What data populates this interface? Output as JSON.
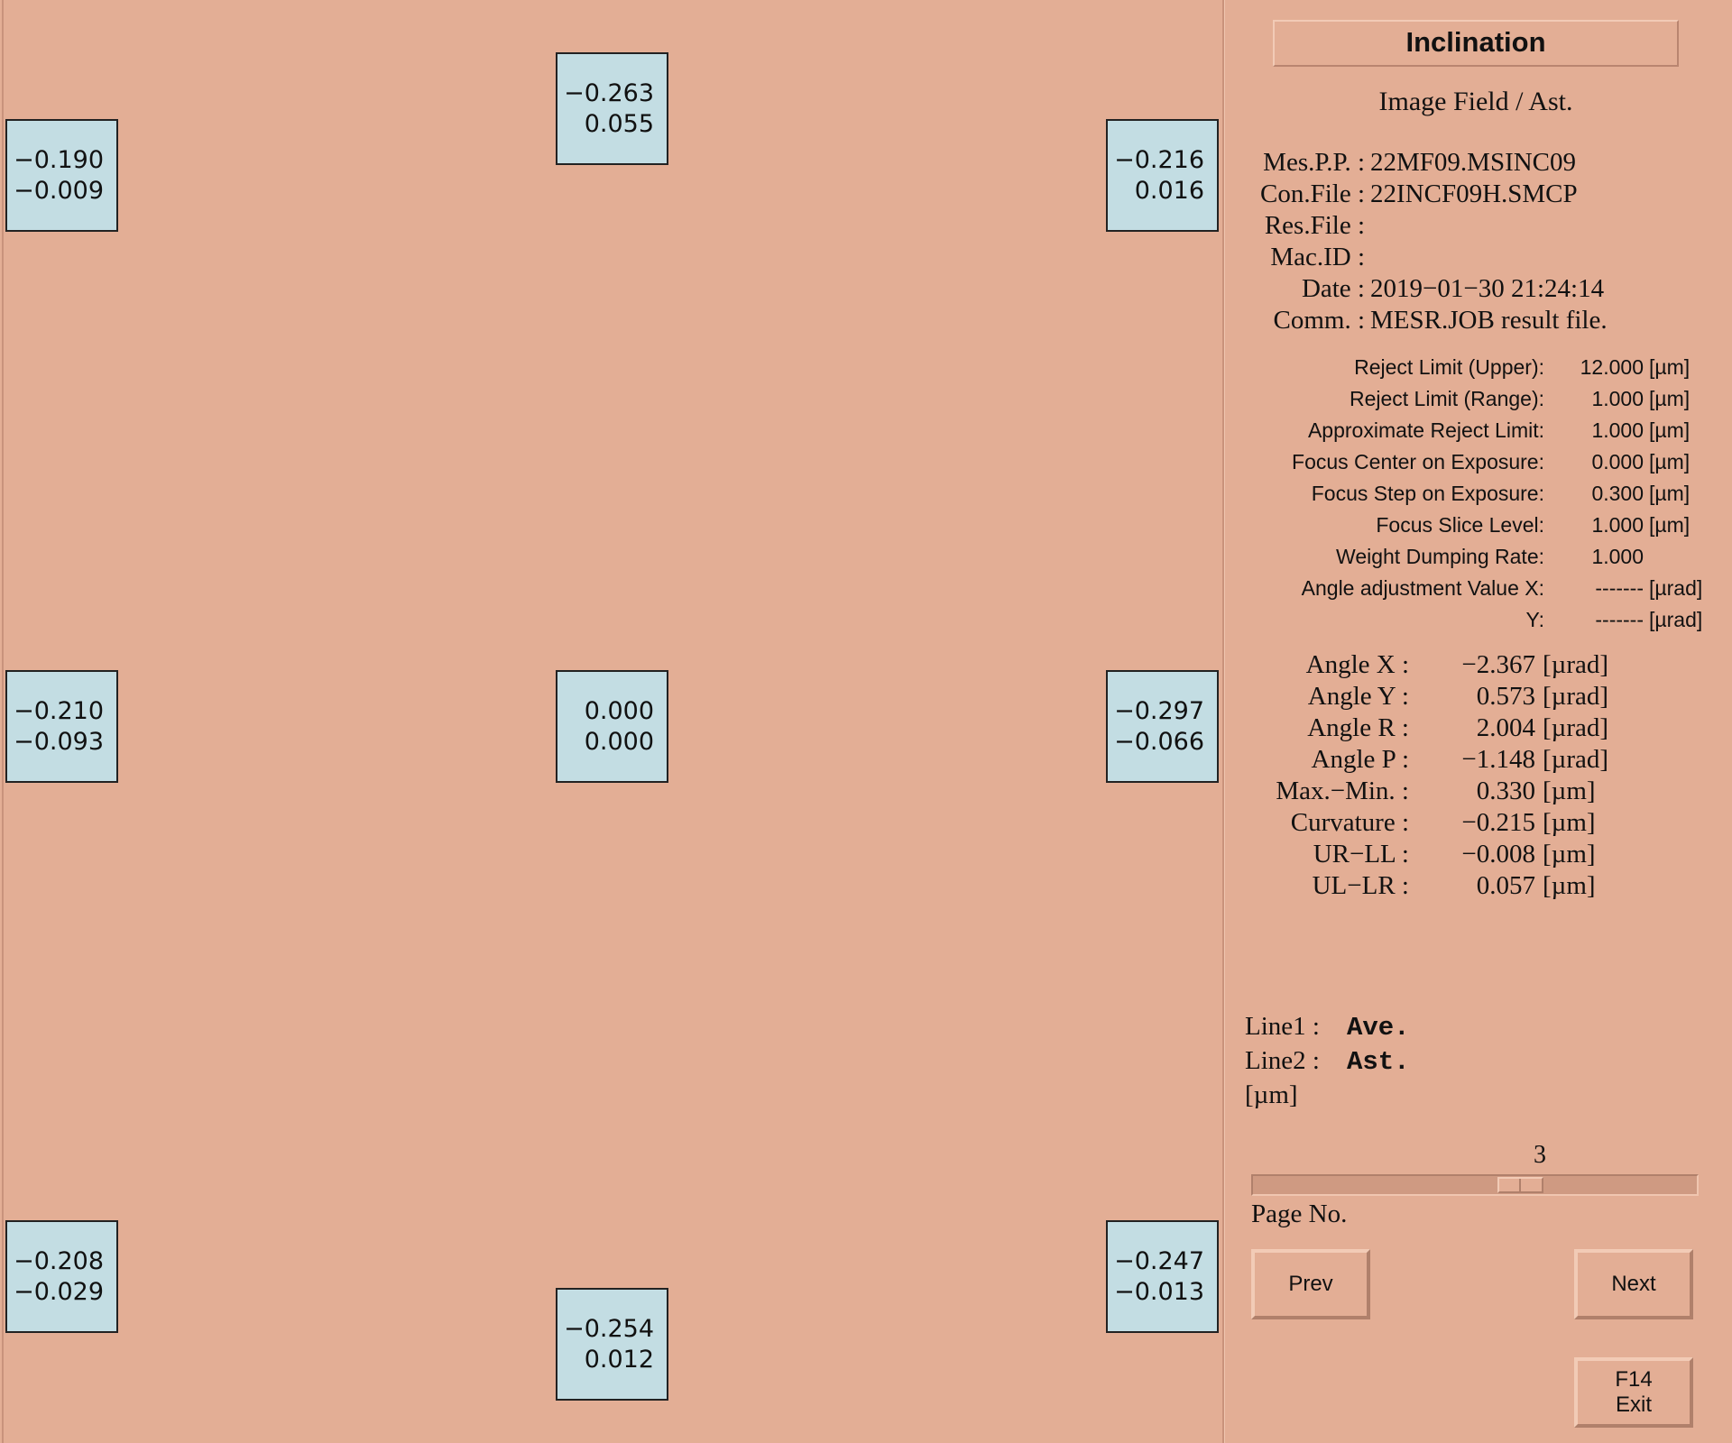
{
  "field_boxes": [
    {
      "pos": "top-left",
      "line1": "−0.190",
      "line2": "−0.009"
    },
    {
      "pos": "top-center",
      "line1": "−0.263",
      "line2": "0.055"
    },
    {
      "pos": "top-right",
      "line1": "−0.216",
      "line2": "0.016"
    },
    {
      "pos": "middle-left",
      "line1": "−0.210",
      "line2": "−0.093"
    },
    {
      "pos": "center",
      "line1": "0.000",
      "line2": "0.000"
    },
    {
      "pos": "middle-right",
      "line1": "−0.297",
      "line2": "−0.066"
    },
    {
      "pos": "bottom-left",
      "line1": "−0.208",
      "line2": "−0.029"
    },
    {
      "pos": "bottom-center",
      "line1": "−0.254",
      "line2": "0.012"
    },
    {
      "pos": "bottom-right",
      "line1": "−0.247",
      "line2": "−0.013"
    }
  ],
  "panel": {
    "title": "Inclination",
    "subtitle": "Image Field / Ast.",
    "info": [
      {
        "k": "Mes.P.P. :",
        "v": "22MF09.MSINC09"
      },
      {
        "k": "Con.File :",
        "v": "22INCF09H.SMCP"
      },
      {
        "k": "Res.File :",
        "v": ""
      },
      {
        "k": "Mac.ID :",
        "v": ""
      },
      {
        "k": "Date :",
        "v": "2019−01−30 21:24:14"
      },
      {
        "k": "Comm. :",
        "v": "MESR.JOB result file."
      }
    ],
    "params": [
      {
        "k": "Reject Limit (Upper):",
        "v": "12.000",
        "u": "[µm]"
      },
      {
        "k": "Reject Limit (Range):",
        "v": "1.000",
        "u": "[µm]"
      },
      {
        "k": "Approximate Reject Limit:",
        "v": "1.000",
        "u": "[µm]"
      },
      {
        "k": "Focus Center on Exposure:",
        "v": "0.000",
        "u": "[µm]"
      },
      {
        "k": "Focus Step on Exposure:",
        "v": "0.300",
        "u": "[µm]"
      },
      {
        "k": "Focus Slice Level:",
        "v": "1.000",
        "u": "[µm]"
      },
      {
        "k": "Weight Dumping Rate:",
        "v": "1.000",
        "u": ""
      },
      {
        "k": "Angle adjustment Value X:",
        "v": "-------",
        "u": "[µrad]"
      },
      {
        "k": "Y:",
        "v": "-------",
        "u": "[µrad]"
      }
    ],
    "angles": [
      {
        "k": "Angle X :",
        "v": "−2.367",
        "u": "[µrad]"
      },
      {
        "k": "Angle Y :",
        "v": "0.573",
        "u": "[µrad]"
      },
      {
        "k": "Angle R :",
        "v": "2.004",
        "u": "[µrad]"
      },
      {
        "k": "Angle P :",
        "v": "−1.148",
        "u": "[µrad]"
      },
      {
        "k": "Max.−Min. :",
        "v": "0.330",
        "u": "[µm]"
      },
      {
        "k": "Curvature :",
        "v": "−0.215",
        "u": "[µm]"
      },
      {
        "k": "UR−LL :",
        "v": "−0.008",
        "u": "[µm]"
      },
      {
        "k": "UL−LR :",
        "v": "0.057",
        "u": "[µm]"
      }
    ],
    "legend": {
      "line1_label": "Line1 :",
      "line1_value": "Ave.",
      "line2_label": "Line2 :",
      "line2_value": "Ast.",
      "unit": "[µm]"
    },
    "page": {
      "value": "3",
      "label": "Page No.",
      "slider_fraction": 0.62
    },
    "buttons": {
      "prev": "Prev",
      "next": "Next",
      "exit_key": "F14",
      "exit": "Exit"
    }
  },
  "colors": {
    "background": "#e3ae95",
    "box": "#c3dde3"
  }
}
